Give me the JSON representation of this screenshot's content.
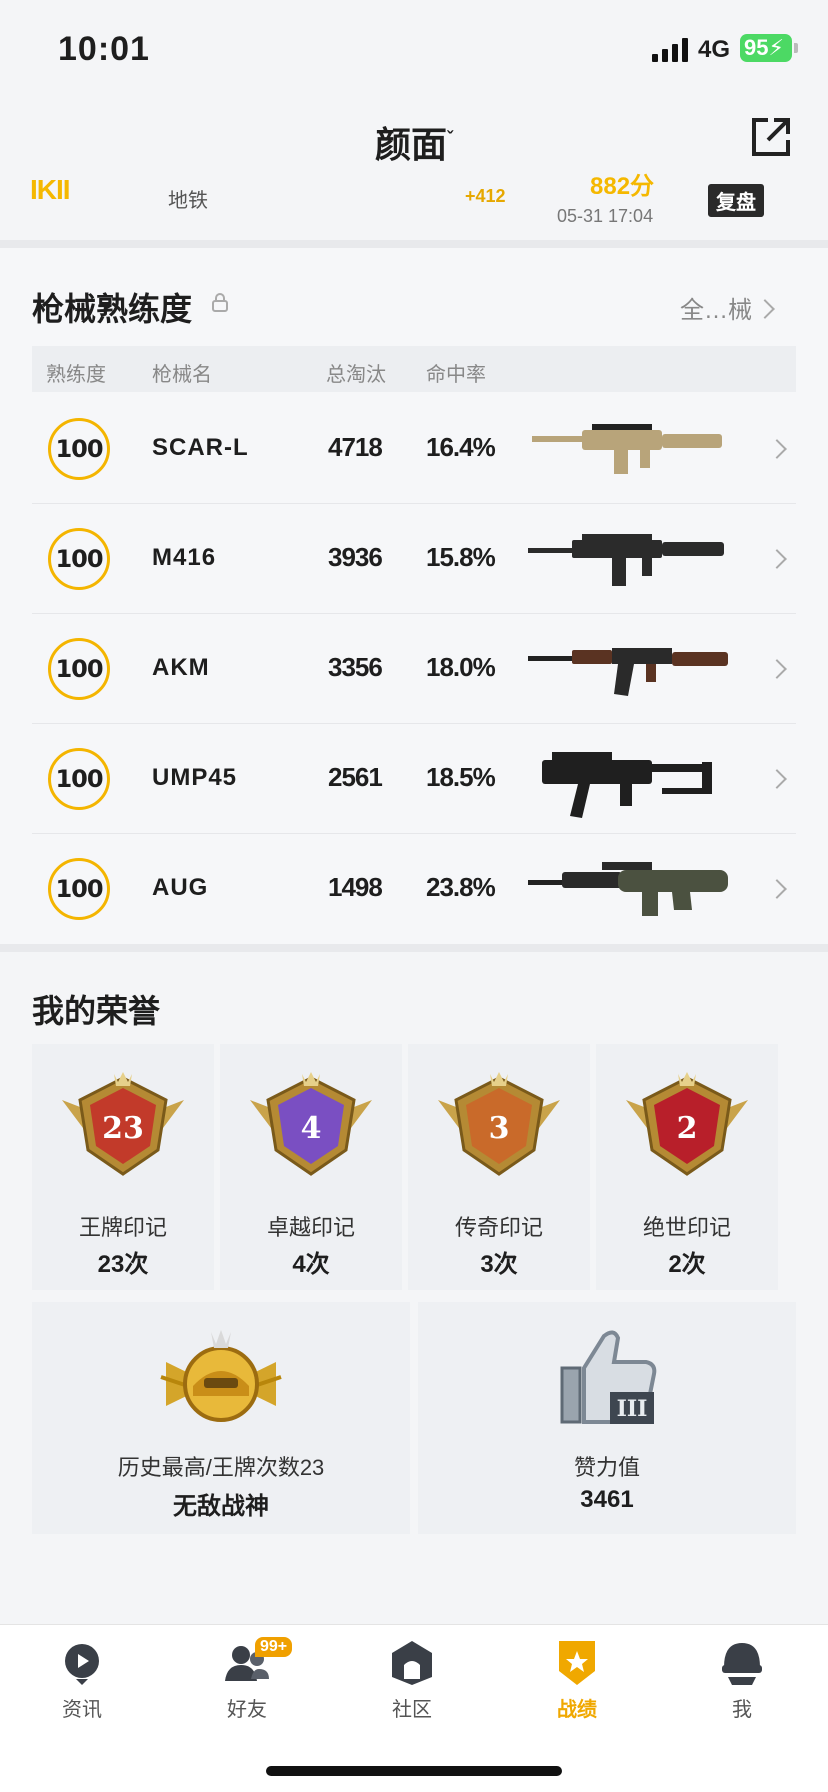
{
  "status_bar": {
    "time": "10:01",
    "network": "4G",
    "battery": "95"
  },
  "header": {
    "title": "颜面",
    "title_mark": "ˇ",
    "share_icon": "share-external-icon"
  },
  "recent_match": {
    "rank_text": "IKII",
    "map": "地铁",
    "score_delta": "+412",
    "rating": "882分",
    "datetime": "05-31 17:04",
    "replay_label": "复盘"
  },
  "weapons": {
    "title": "枪械熟练度",
    "all_label": "全…械",
    "headers": {
      "mastery": "熟练度",
      "name": "枪械名",
      "kills": "总淘汰",
      "accuracy": "命中率"
    },
    "rows": [
      {
        "level": "100",
        "name": "SCAR-L",
        "kills": "4718",
        "accuracy": "16.4%",
        "color": "#b8a47a"
      },
      {
        "level": "100",
        "name": "M416",
        "kills": "3936",
        "accuracy": "15.8%",
        "color": "#2b2b2b"
      },
      {
        "level": "100",
        "name": "AKM",
        "kills": "3356",
        "accuracy": "18.0%",
        "color": "#5a3322"
      },
      {
        "level": "100",
        "name": "UMP45",
        "kills": "2561",
        "accuracy": "18.5%",
        "color": "#1f1f1f"
      },
      {
        "level": "100",
        "name": "AUG",
        "kills": "1498",
        "accuracy": "23.8%",
        "color": "#4b5140"
      }
    ]
  },
  "honors": {
    "title": "我的荣誉",
    "cards": [
      {
        "label": "王牌印记",
        "count": "23次",
        "emblem_number": "23",
        "color": "#c23a2a"
      },
      {
        "label": "卓越印记",
        "count": "4次",
        "emblem_number": "4",
        "color": "#7a4fc2"
      },
      {
        "label": "传奇印记",
        "count": "3次",
        "emblem_number": "3",
        "color": "#c96a2a"
      },
      {
        "label": "绝世印记",
        "count": "2次",
        "emblem_number": "2",
        "color": "#b81f2a"
      }
    ],
    "best": {
      "label": "历史最高/王牌次数23",
      "value": "无敌战神"
    },
    "likes": {
      "label": "赞力值",
      "value": "3461"
    }
  },
  "tabbar": {
    "items": [
      {
        "label": "资讯",
        "icon": "news-icon"
      },
      {
        "label": "好友",
        "icon": "friends-icon",
        "badge": "99+"
      },
      {
        "label": "社区",
        "icon": "community-icon"
      },
      {
        "label": "战绩",
        "icon": "record-icon",
        "active": true
      },
      {
        "label": "我",
        "icon": "profile-icon"
      }
    ]
  }
}
